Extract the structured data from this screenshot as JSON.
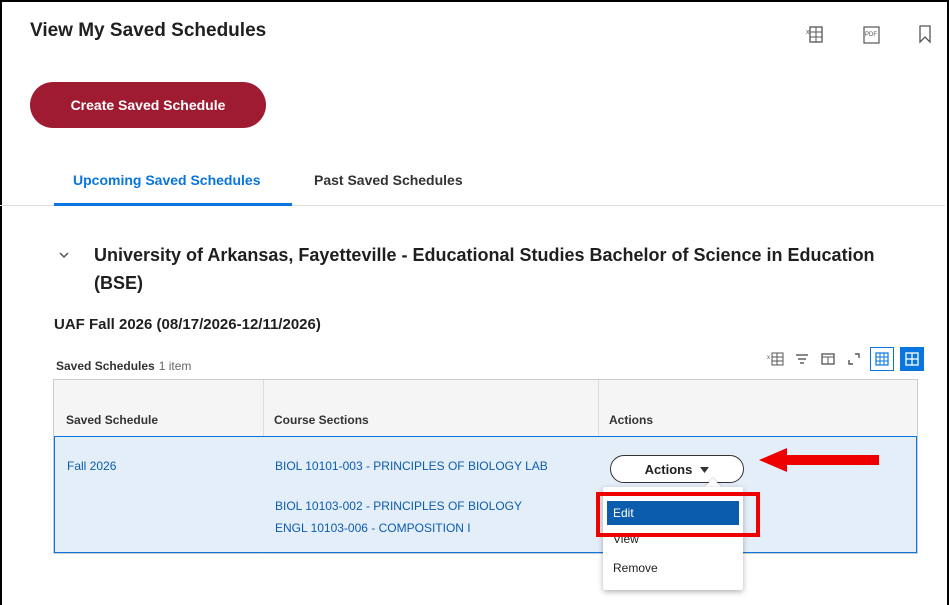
{
  "header": {
    "title": "View My Saved Schedules",
    "icons": [
      "export-to-excel-icon",
      "export-to-pdf-icon",
      "bookmark-icon"
    ]
  },
  "create_button": {
    "label": "Create Saved Schedule"
  },
  "tabs": [
    {
      "label": "Upcoming Saved Schedules",
      "active": true
    },
    {
      "label": "Past Saved Schedules",
      "active": false
    }
  ],
  "program": {
    "title": "University of Arkansas, Fayetteville - Educational Studies Bachelor of Science in Education (BSE)"
  },
  "term": {
    "title": "UAF Fall 2026 (08/17/2026-12/11/2026)"
  },
  "table": {
    "caption": "Saved Schedules",
    "count": "1 item",
    "columns": [
      "Saved Schedule",
      "Course Sections",
      "Actions"
    ],
    "rows": [
      {
        "saved_schedule": "Fall 2026",
        "sections": [
          "BIOL 10101-003 - PRINCIPLES OF BIOLOGY LAB",
          "BIOL 10103-002 - PRINCIPLES OF BIOLOGY",
          "ENGL 10103-006 - COMPOSITION I"
        ],
        "actions_label": "Actions"
      }
    ]
  },
  "actions_menu": {
    "items": [
      "Edit",
      "View",
      "Remove"
    ],
    "selected": "Edit"
  },
  "colors": {
    "brand": "#9e1b32",
    "accent": "#0875e1",
    "link": "#0b5cad",
    "annotation": "#e00000"
  }
}
